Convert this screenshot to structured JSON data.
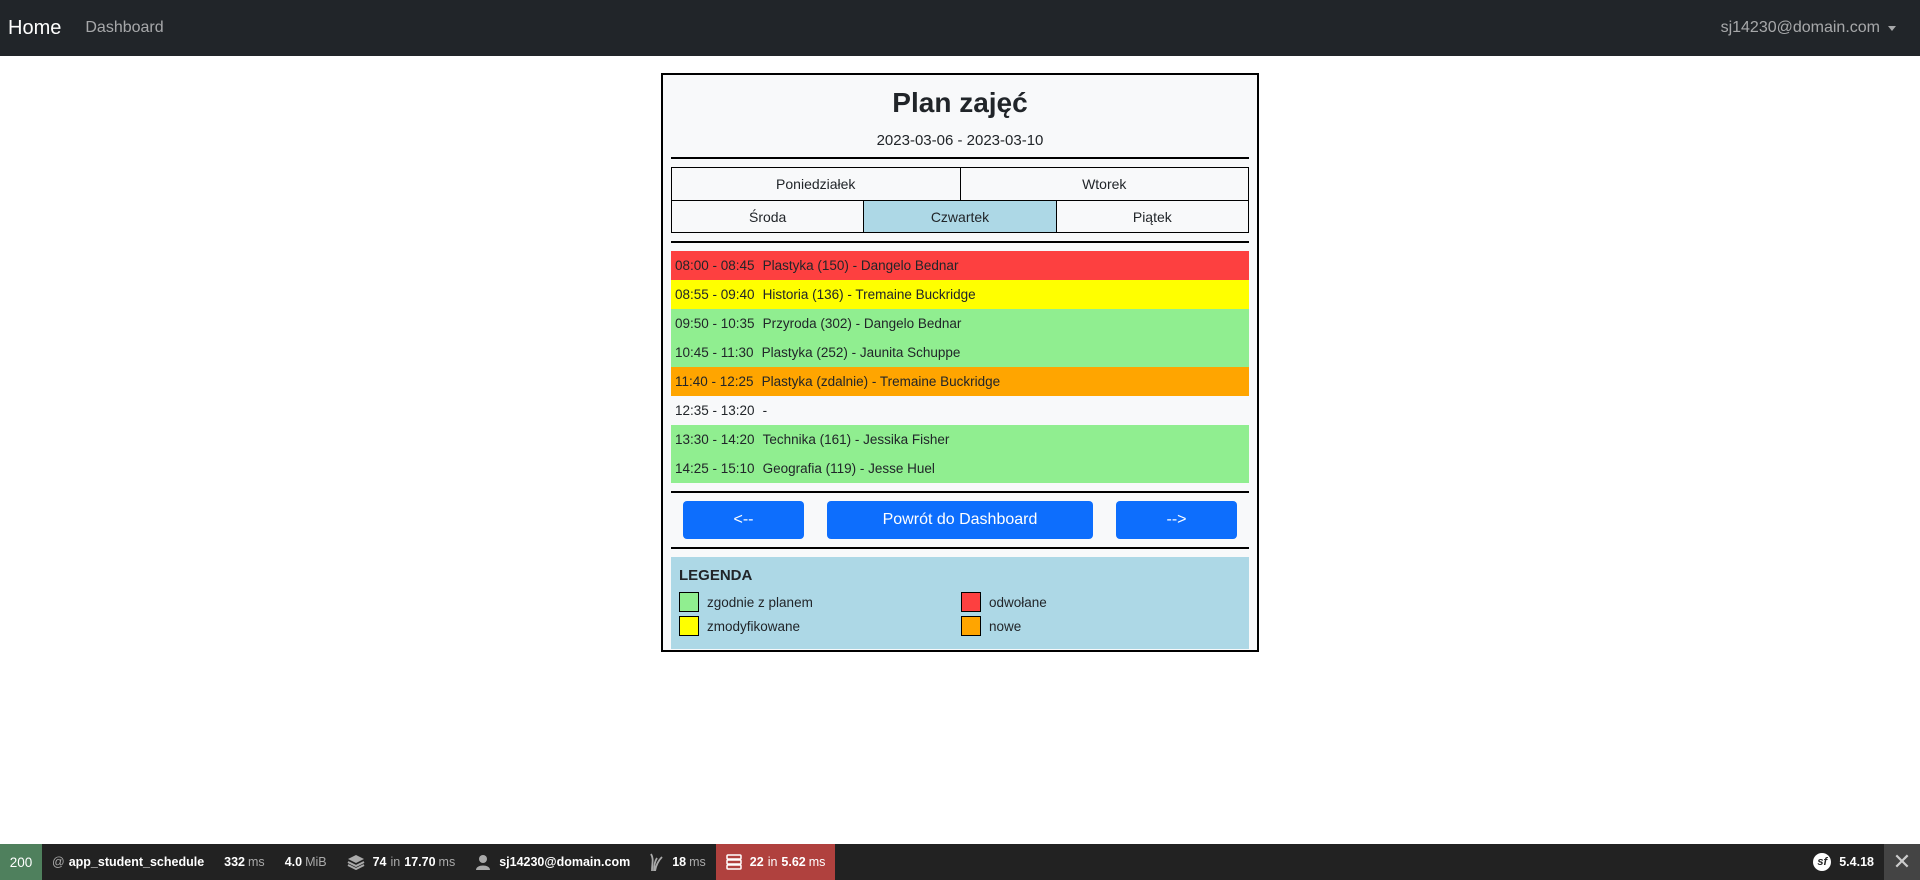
{
  "navbar": {
    "brand": "Home",
    "links": [
      "Dashboard"
    ],
    "user": "sj14230@domain.com"
  },
  "schedule": {
    "title": "Plan zajęć",
    "date_range": "2023-03-06 - 2023-03-10",
    "days_row1": [
      "Poniedziałek",
      "Wtorek"
    ],
    "days_row2": [
      "Środa",
      "Czwartek",
      "Piątek"
    ],
    "active_day": "Czwartek",
    "lessons": [
      {
        "time": "08:00 - 08:45",
        "text": "Plastyka (150) - Dangelo Bednar",
        "status": "odwołane"
      },
      {
        "time": "08:55 - 09:40",
        "text": "Historia (136) - Tremaine Buckridge",
        "status": "zmodyfikowane"
      },
      {
        "time": "09:50 - 10:35",
        "text": "Przyroda (302) - Dangelo Bednar",
        "status": "zgodnie z planem"
      },
      {
        "time": "10:45 - 11:30",
        "text": "Plastyka (252) - Jaunita Schuppe",
        "status": "zgodnie z planem"
      },
      {
        "time": "11:40 - 12:25",
        "text": "Plastyka (zdalnie) - Tremaine Buckridge",
        "status": "nowe"
      },
      {
        "time": "12:35 - 13:20",
        "text": "-",
        "status": ""
      },
      {
        "time": "13:30 - 14:20",
        "text": "Technika (161) - Jessika Fisher",
        "status": "zgodnie z planem"
      },
      {
        "time": "14:25 - 15:10",
        "text": "Geografia (119) - Jesse Huel",
        "status": "zgodnie z planem"
      }
    ],
    "buttons": {
      "prev": "<--",
      "back": "Powrót do Dashboard",
      "next": "-->"
    }
  },
  "legend": {
    "title": "LEGENDA",
    "items": [
      {
        "label": "zgodnie z planem",
        "color": "#90ee90"
      },
      {
        "label": "odwołane",
        "color": "#fd4040"
      },
      {
        "label": "zmodyfikowane",
        "color": "#ffff00"
      },
      {
        "label": "nowe",
        "color": "#ffa500"
      }
    ]
  },
  "toolbar": {
    "status_code": "200",
    "route_prefix": "@",
    "route": "app_student_schedule",
    "time_value": "332",
    "time_unit": "ms",
    "memory_value": "4.0",
    "memory_unit": "MiB",
    "cache_count": "74",
    "cache_in": "in",
    "cache_time": "17.70",
    "cache_unit": "ms",
    "user": "sj14230@domain.com",
    "twig_time": "18",
    "twig_unit": "ms",
    "db_count": "22",
    "db_in": "in",
    "db_time": "5.62",
    "db_unit": "ms",
    "sf_logo": "sf",
    "version": "5.4.18",
    "close": "✕"
  }
}
